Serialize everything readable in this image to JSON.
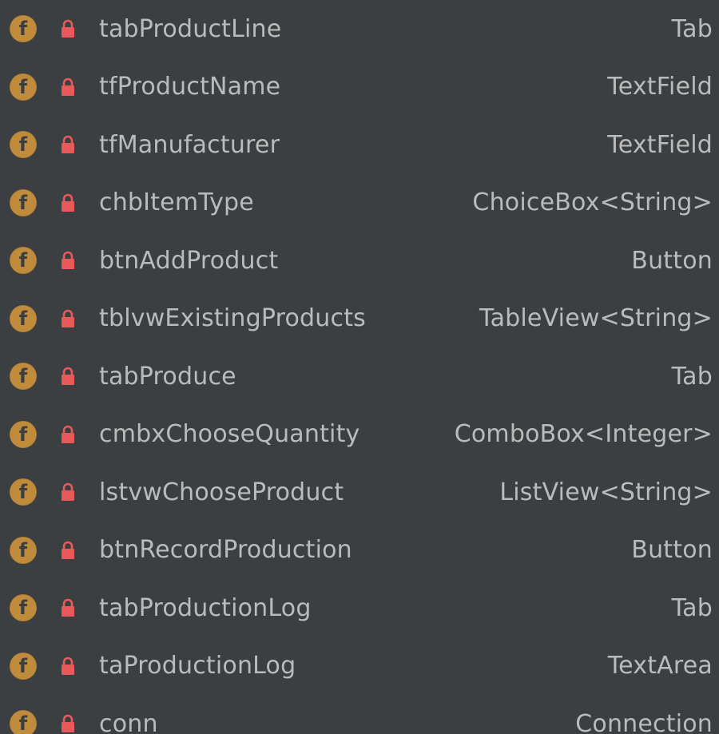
{
  "structure": {
    "fields": [
      {
        "name": "tabProductLine",
        "type": "Tab",
        "icon": "field-icon",
        "visibility_icon": "lock-icon"
      },
      {
        "name": "tfProductName",
        "type": "TextField",
        "icon": "field-icon",
        "visibility_icon": "lock-icon"
      },
      {
        "name": "tfManufacturer",
        "type": "TextField",
        "icon": "field-icon",
        "visibility_icon": "lock-icon"
      },
      {
        "name": "chbItemType",
        "type": "ChoiceBox<String>",
        "icon": "field-icon",
        "visibility_icon": "lock-icon"
      },
      {
        "name": "btnAddProduct",
        "type": "Button",
        "icon": "field-icon",
        "visibility_icon": "lock-icon"
      },
      {
        "name": "tblvwExistingProducts",
        "type": "TableView<String>",
        "icon": "field-icon",
        "visibility_icon": "lock-icon"
      },
      {
        "name": "tabProduce",
        "type": "Tab",
        "icon": "field-icon",
        "visibility_icon": "lock-icon"
      },
      {
        "name": "cmbxChooseQuantity",
        "type": "ComboBox<Integer>",
        "icon": "field-icon",
        "visibility_icon": "lock-icon"
      },
      {
        "name": "lstvwChooseProduct",
        "type": "ListView<String>",
        "icon": "field-icon",
        "visibility_icon": "lock-icon"
      },
      {
        "name": "btnRecordProduction",
        "type": "Button",
        "icon": "field-icon",
        "visibility_icon": "lock-icon"
      },
      {
        "name": "tabProductionLog",
        "type": "Tab",
        "icon": "field-icon",
        "visibility_icon": "lock-icon"
      },
      {
        "name": "taProductionLog",
        "type": "TextArea",
        "icon": "field-icon",
        "visibility_icon": "lock-icon"
      },
      {
        "name": "conn",
        "type": "Connection",
        "icon": "field-icon",
        "visibility_icon": "lock-icon"
      }
    ],
    "field_icon_letter": "f"
  },
  "colors": {
    "background": "#3c3f41",
    "text": "#bbbbbb",
    "field_icon": "#c08c3c",
    "lock": "#e85a5a"
  }
}
